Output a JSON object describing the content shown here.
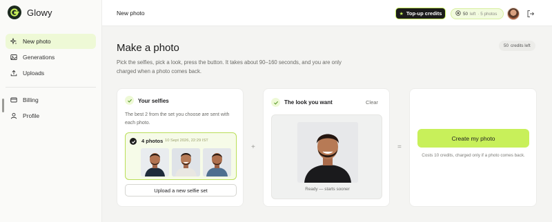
{
  "app": {
    "name": "Glowy"
  },
  "sidebar": {
    "items": [
      {
        "label": "New photo",
        "icon": "sparkle-icon"
      },
      {
        "label": "Generations",
        "icon": "image-icon"
      },
      {
        "label": "Uploads",
        "icon": "upload-icon"
      },
      {
        "label": "Billing",
        "icon": "card-icon"
      },
      {
        "label": "Profile",
        "icon": "user-icon"
      }
    ]
  },
  "topbar": {
    "title": "New photo",
    "topup_label": "Top-up credits",
    "credits_count": "50",
    "credits_left_word": "left",
    "photos_text": "· 5 photos"
  },
  "main": {
    "title": "Make a photo",
    "subtitle": "Pick the selfies, pick a look, press the button. It takes about 90–160 seconds, and you are only charged when a photo comes back.",
    "credits_left_count": "50",
    "credits_left_label": "credits left"
  },
  "selfies_card": {
    "title": "Your selfies",
    "description": "The best 2 from the set you choose are sent with each photo.",
    "set_count": "4 photos",
    "set_date": "10 Sept 2026, 22:29 IST",
    "upload_label": "Upload a new selfie set"
  },
  "look_card": {
    "title": "The look you want",
    "clear_label": "Clear",
    "caption": "Ready — starts sooner"
  },
  "create_card": {
    "button_label": "Create my photo",
    "note": "Costs 10 credits, charged only if a photo comes back."
  },
  "operators": {
    "plus": "+",
    "equals": "="
  },
  "colors": {
    "accent": "#c8f05a",
    "dark": "#1b1b1b"
  }
}
